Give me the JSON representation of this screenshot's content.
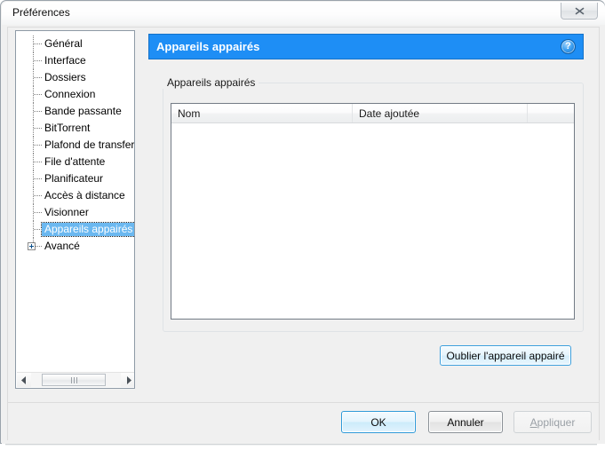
{
  "window": {
    "title": "Préférences",
    "close_label": "✕",
    "close_icon": "close-icon"
  },
  "sidebar": {
    "items": [
      {
        "label": "Général",
        "selected": false,
        "expandable": false
      },
      {
        "label": "Interface",
        "selected": false,
        "expandable": false
      },
      {
        "label": "Dossiers",
        "selected": false,
        "expandable": false
      },
      {
        "label": "Connexion",
        "selected": false,
        "expandable": false
      },
      {
        "label": "Bande passante",
        "selected": false,
        "expandable": false
      },
      {
        "label": "BitTorrent",
        "selected": false,
        "expandable": false
      },
      {
        "label": "Plafond de transfert",
        "selected": false,
        "expandable": false
      },
      {
        "label": "File d'attente",
        "selected": false,
        "expandable": false
      },
      {
        "label": "Planificateur",
        "selected": false,
        "expandable": false
      },
      {
        "label": "Accès à distance",
        "selected": false,
        "expandable": false
      },
      {
        "label": "Visionner",
        "selected": false,
        "expandable": false
      },
      {
        "label": "Appareils appairés",
        "selected": true,
        "expandable": false
      },
      {
        "label": "Avancé",
        "selected": false,
        "expandable": true
      }
    ],
    "scrollbar": {
      "left_arrow_icon": "chevron-left-icon",
      "right_arrow_icon": "chevron-right-icon"
    }
  },
  "main": {
    "banner": {
      "title": "Appareils appairés",
      "help_icon": "help-icon",
      "help_label": "?",
      "color": "#1e8ef5"
    },
    "group": {
      "label": "Appareils appairés"
    },
    "table": {
      "columns": [
        "Nom",
        "Date ajoutée",
        ""
      ],
      "rows": []
    },
    "forget_button": "Oublier l'appareil appairé"
  },
  "footer": {
    "ok": "OK",
    "cancel": "Annuler",
    "apply_mnemonic": "A",
    "apply_rest": "ppliquer"
  }
}
